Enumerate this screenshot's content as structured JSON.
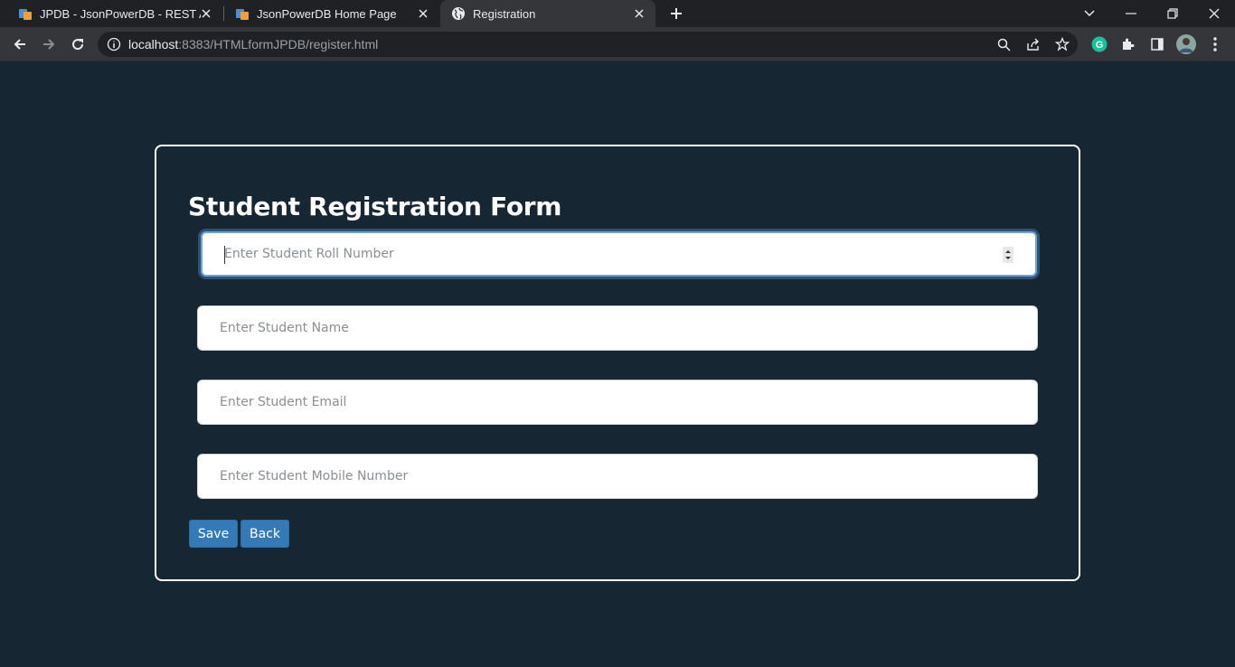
{
  "browser": {
    "tabs": [
      {
        "title": "JPDB - JsonPowerDB - REST API J",
        "active": false,
        "icon": "jpdb-favicon"
      },
      {
        "title": "JsonPowerDB Home Page",
        "active": false,
        "icon": "jpdb-favicon"
      },
      {
        "title": "Registration",
        "active": true,
        "icon": "globe-icon"
      }
    ],
    "url_host": "localhost",
    "url_rest": ":8383/HTMLformJPDB/register.html",
    "profile_initial": "G"
  },
  "form": {
    "title": "Student Registration Form",
    "fields": [
      {
        "placeholder": "Enter Student Roll Number",
        "value": "",
        "type": "number"
      },
      {
        "placeholder": "Enter Student Name",
        "value": "",
        "type": "text"
      },
      {
        "placeholder": "Enter Student Email",
        "value": "",
        "type": "email"
      },
      {
        "placeholder": "Enter Student Mobile Number",
        "value": "",
        "type": "text"
      }
    ],
    "save_label": "Save",
    "back_label": "Back"
  },
  "colors": {
    "page_bg": "#172633",
    "button_bg": "#337ab7",
    "focus_ring": "#6aa6dd"
  }
}
